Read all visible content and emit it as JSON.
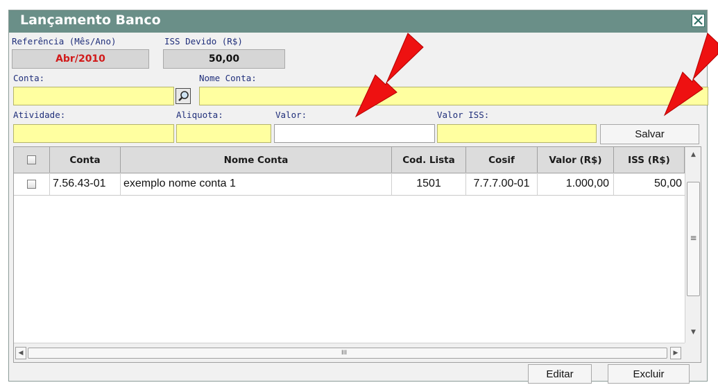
{
  "window": {
    "title": "Lançamento Banco",
    "close_label": "close"
  },
  "referencia": {
    "label": "Referência (Mês/Ano)",
    "value": "Abr/2010",
    "value_color": "#d11a1a"
  },
  "iss_devido": {
    "label": "ISS Devido (R$)",
    "value": "50,00"
  },
  "conta": {
    "label": "Conta:",
    "value": ""
  },
  "nome_conta": {
    "label": "Nome Conta:",
    "value": ""
  },
  "atividade": {
    "label": "Atividade:",
    "value": ""
  },
  "aliquota": {
    "label": "Aliquota:",
    "value": ""
  },
  "valor": {
    "label": "Valor:",
    "value": ""
  },
  "valor_iss": {
    "label": "Valor ISS:",
    "value": ""
  },
  "buttons": {
    "salvar": "Salvar",
    "editar": "Editar",
    "excluir": "Excluir"
  },
  "table": {
    "columns": [
      "Conta",
      "Nome Conta",
      "Cod. Lista",
      "Cosif",
      "Valor (R$)",
      "ISS (R$)"
    ],
    "rows": [
      {
        "conta": "7.56.43-01",
        "nome_conta": "exemplo nome conta 1",
        "cod_lista": "1501",
        "cosif": "7.7.7.00-01",
        "valor": "1.000,00",
        "iss": "50,00",
        "checked": false
      }
    ]
  },
  "colors": {
    "titlebar": "#6a8f88",
    "input_bg": "#ffffa0",
    "label": "#1f2e7a",
    "annotation_arrow": "#ee1111"
  },
  "icons": {
    "close": "close-icon",
    "lookup": "magnifier-icon"
  },
  "scroll_glyphs": {
    "up": "▲",
    "down": "▼",
    "left": "◀",
    "right": "▶",
    "v_grip": "≡",
    "h_grip": "III"
  }
}
